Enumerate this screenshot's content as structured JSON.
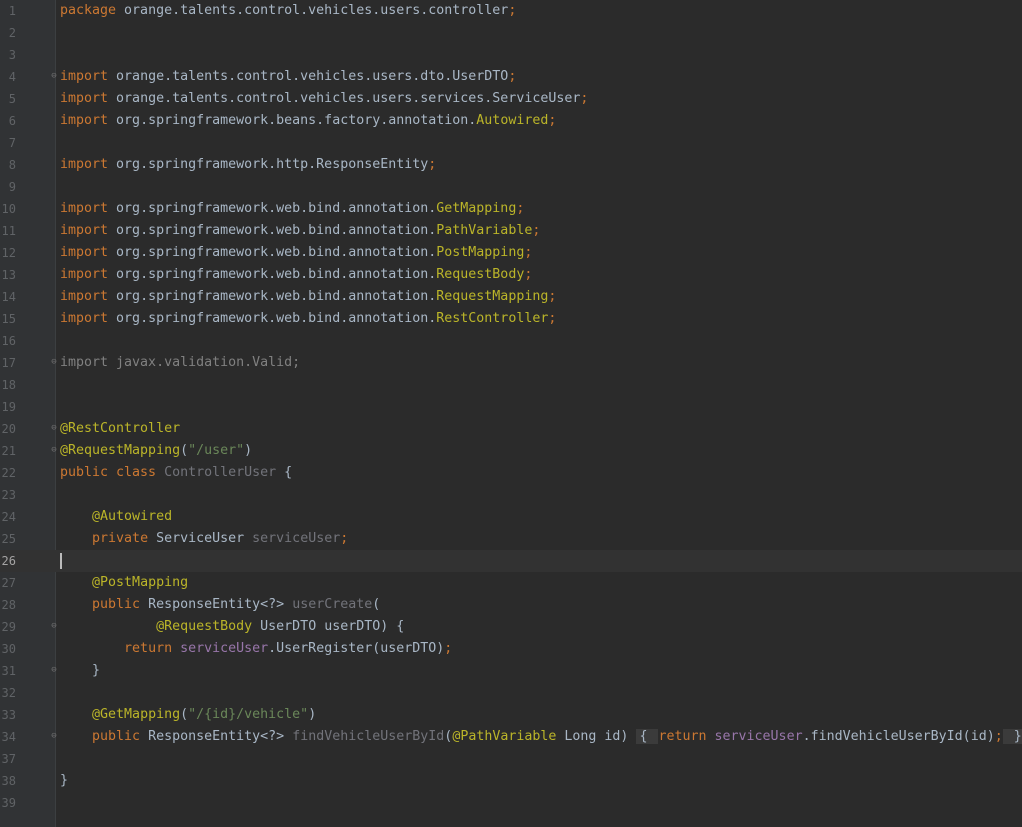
{
  "editor": {
    "current_line": "26",
    "lines": [
      {
        "n": "1",
        "tokens": [
          [
            "kw",
            "package "
          ],
          [
            "pl",
            "orange.talents.control.vehicles.users.controller"
          ],
          [
            "kw",
            ";"
          ]
        ]
      },
      {
        "n": "2",
        "tokens": []
      },
      {
        "n": "3",
        "tokens": []
      },
      {
        "n": "4",
        "fold": true,
        "tokens": [
          [
            "kw",
            "import "
          ],
          [
            "pl",
            "orange.talents.control.vehicles.users.dto.UserDTO"
          ],
          [
            "kw",
            ";"
          ]
        ]
      },
      {
        "n": "5",
        "tokens": [
          [
            "kw",
            "import "
          ],
          [
            "pl",
            "orange.talents.control.vehicles.users.services.ServiceUser"
          ],
          [
            "kw",
            ";"
          ]
        ]
      },
      {
        "n": "6",
        "tokens": [
          [
            "kw",
            "import "
          ],
          [
            "pl",
            "org.springframework.beans.factory.annotation."
          ],
          [
            "an",
            "Autowired"
          ],
          [
            "kw",
            ";"
          ]
        ]
      },
      {
        "n": "7",
        "tokens": []
      },
      {
        "n": "8",
        "tokens": [
          [
            "kw",
            "import "
          ],
          [
            "pl",
            "org.springframework.http.ResponseEntity"
          ],
          [
            "kw",
            ";"
          ]
        ]
      },
      {
        "n": "9",
        "tokens": []
      },
      {
        "n": "10",
        "tokens": [
          [
            "kw",
            "import "
          ],
          [
            "pl",
            "org.springframework.web.bind.annotation."
          ],
          [
            "an",
            "GetMapping"
          ],
          [
            "kw",
            ";"
          ]
        ]
      },
      {
        "n": "11",
        "tokens": [
          [
            "kw",
            "import "
          ],
          [
            "pl",
            "org.springframework.web.bind.annotation."
          ],
          [
            "an",
            "PathVariable"
          ],
          [
            "kw",
            ";"
          ]
        ]
      },
      {
        "n": "12",
        "tokens": [
          [
            "kw",
            "import "
          ],
          [
            "pl",
            "org.springframework.web.bind.annotation."
          ],
          [
            "an",
            "PostMapping"
          ],
          [
            "kw",
            ";"
          ]
        ]
      },
      {
        "n": "13",
        "tokens": [
          [
            "kw",
            "import "
          ],
          [
            "pl",
            "org.springframework.web.bind.annotation."
          ],
          [
            "an",
            "RequestBody"
          ],
          [
            "kw",
            ";"
          ]
        ]
      },
      {
        "n": "14",
        "tokens": [
          [
            "kw",
            "import "
          ],
          [
            "pl",
            "org.springframework.web.bind.annotation."
          ],
          [
            "an",
            "RequestMapping"
          ],
          [
            "kw",
            ";"
          ]
        ]
      },
      {
        "n": "15",
        "tokens": [
          [
            "kw",
            "import "
          ],
          [
            "pl",
            "org.springframework.web.bind.annotation."
          ],
          [
            "an",
            "RestController"
          ],
          [
            "kw",
            ";"
          ]
        ]
      },
      {
        "n": "16",
        "tokens": []
      },
      {
        "n": "17",
        "fold": true,
        "tokens": [
          [
            "gr",
            "import javax.validation.Valid;"
          ]
        ]
      },
      {
        "n": "18",
        "tokens": []
      },
      {
        "n": "19",
        "tokens": []
      },
      {
        "n": "20",
        "fold": true,
        "tokens": [
          [
            "an",
            "@RestController"
          ]
        ]
      },
      {
        "n": "21",
        "fold": true,
        "tokens": [
          [
            "an",
            "@RequestMapping"
          ],
          [
            "pl",
            "("
          ],
          [
            "st",
            "\"/user\""
          ],
          [
            "pl",
            ")"
          ]
        ]
      },
      {
        "n": "22",
        "tokens": [
          [
            "kw",
            "public class "
          ],
          [
            "un",
            "ControllerUser"
          ],
          [
            "pl",
            " {"
          ]
        ]
      },
      {
        "n": "23",
        "tokens": []
      },
      {
        "n": "24",
        "tokens": [
          [
            "pl",
            "    "
          ],
          [
            "an",
            "@Autowired"
          ]
        ]
      },
      {
        "n": "25",
        "tokens": [
          [
            "pl",
            "    "
          ],
          [
            "kw",
            "private "
          ],
          [
            "pl",
            "ServiceUser "
          ],
          [
            "un",
            "serviceUser"
          ],
          [
            "kw",
            ";"
          ]
        ]
      },
      {
        "n": "26",
        "current": true,
        "tokens": []
      },
      {
        "n": "27",
        "tokens": [
          [
            "pl",
            "    "
          ],
          [
            "an",
            "@PostMapping"
          ]
        ]
      },
      {
        "n": "28",
        "tokens": [
          [
            "pl",
            "    "
          ],
          [
            "kw",
            "public "
          ],
          [
            "pl",
            "ResponseEntity<?> "
          ],
          [
            "un",
            "userCreate"
          ],
          [
            "pl",
            "("
          ]
        ]
      },
      {
        "n": "29",
        "fold": true,
        "tokens": [
          [
            "pl",
            "            "
          ],
          [
            "an",
            "@RequestBody "
          ],
          [
            "pl",
            "UserDTO userDTO) {"
          ]
        ]
      },
      {
        "n": "30",
        "tokens": [
          [
            "pl",
            "        "
          ],
          [
            "kw",
            "return "
          ],
          [
            "fd",
            "serviceUser"
          ],
          [
            "pl",
            ".UserRegister(userDTO)"
          ],
          [
            "kw",
            ";"
          ]
        ]
      },
      {
        "n": "31",
        "fold": true,
        "tokens": [
          [
            "pl",
            "    }"
          ]
        ]
      },
      {
        "n": "32",
        "tokens": []
      },
      {
        "n": "33",
        "tokens": [
          [
            "pl",
            "    "
          ],
          [
            "an",
            "@GetMapping"
          ],
          [
            "pl",
            "("
          ],
          [
            "st",
            "\"/{id}/vehicle\""
          ],
          [
            "pl",
            ")"
          ]
        ]
      },
      {
        "n": "34",
        "fold": true,
        "tokens": [
          [
            "pl",
            "    "
          ],
          [
            "kw",
            "public "
          ],
          [
            "pl",
            "ResponseEntity<?> "
          ],
          [
            "un",
            "findVehicleUserById"
          ],
          [
            "pl",
            "("
          ],
          [
            "an",
            "@PathVariable "
          ],
          [
            "pl",
            "Long id) "
          ],
          [
            "box",
            "{ "
          ],
          [
            "kw",
            "return "
          ],
          [
            "fd",
            "serviceUser"
          ],
          [
            "pl",
            ".findVehicleUserById(id)"
          ],
          [
            "kw",
            ";"
          ],
          [
            "box",
            " }"
          ]
        ]
      },
      {
        "n": "37",
        "tokens": []
      },
      {
        "n": "38",
        "tokens": [
          [
            "pl",
            "}"
          ]
        ]
      },
      {
        "n": "39",
        "tokens": []
      }
    ]
  }
}
